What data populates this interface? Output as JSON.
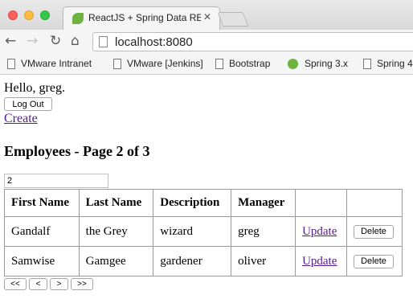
{
  "browser": {
    "tab": {
      "title": "ReactJS + Spring Data RE",
      "close_glyph": "✕",
      "favicon": "spring-leaf-icon"
    },
    "nav": {
      "back_glyph": "←",
      "forward_glyph": "→",
      "reload_glyph": "↻",
      "home_glyph": "⌂"
    },
    "url": "localhost:8080",
    "bookmarks": [
      {
        "label": "VMware Intranet",
        "icon": "page-icon"
      },
      {
        "label": "VMware [Jenkins]",
        "icon": "page-icon"
      },
      {
        "label": "Bootstrap",
        "icon": "page-icon"
      },
      {
        "label": "Spring 3.x",
        "icon": "spring-icon"
      },
      {
        "label": "Spring 4",
        "icon": "page-icon"
      }
    ]
  },
  "page": {
    "greeting": "Hello, greg.",
    "logout_label": "Log Out",
    "create_label": "Create",
    "heading": "Employees - Page 2 of 3",
    "page_size_value": "2",
    "table": {
      "headers": [
        "First Name",
        "Last Name",
        "Description",
        "Manager",
        "",
        ""
      ],
      "rows": [
        {
          "first": "Gandalf",
          "last": "the Grey",
          "description": "wizard",
          "manager": "greg",
          "update": "Update",
          "delete": "Delete"
        },
        {
          "first": "Samwise",
          "last": "Gamgee",
          "description": "gardener",
          "manager": "oliver",
          "update": "Update",
          "delete": "Delete"
        }
      ]
    },
    "pager": {
      "first": "<<",
      "prev": "<",
      "next": ">",
      "last": ">>"
    }
  },
  "colors": {
    "visited_link": "#551a8b",
    "spring_green": "#6db33f"
  }
}
